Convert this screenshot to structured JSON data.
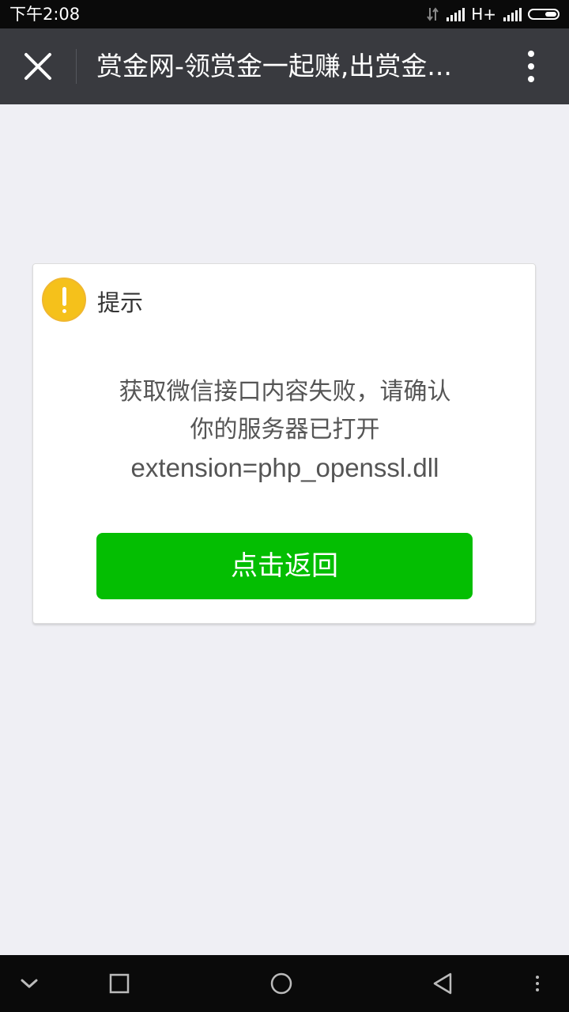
{
  "status_bar": {
    "time": "下午2:08",
    "network": "H+"
  },
  "title_bar": {
    "title": "赏金网-领赏金一起赚,出赏金..."
  },
  "dialog": {
    "title": "提示",
    "message_lines": [
      "获取微信接口内容失败，请确认",
      "你的服务器已打开",
      "extension=php_openssl.dll"
    ],
    "button_label": "点击返回"
  },
  "colors": {
    "status_bar_bg": "#0a0a0a",
    "title_bar_bg": "#393a3f",
    "page_bg": "#efeff4",
    "primary_button": "#04be02",
    "warning_icon": "#f5c11b"
  },
  "icons": {
    "close": "close-icon",
    "more": "more-vertical-icon",
    "warning": "warning-icon",
    "nav": [
      "chevron-down-icon",
      "recents-square-icon",
      "home-circle-icon",
      "back-triangle-icon",
      "menu-dots-icon"
    ]
  }
}
